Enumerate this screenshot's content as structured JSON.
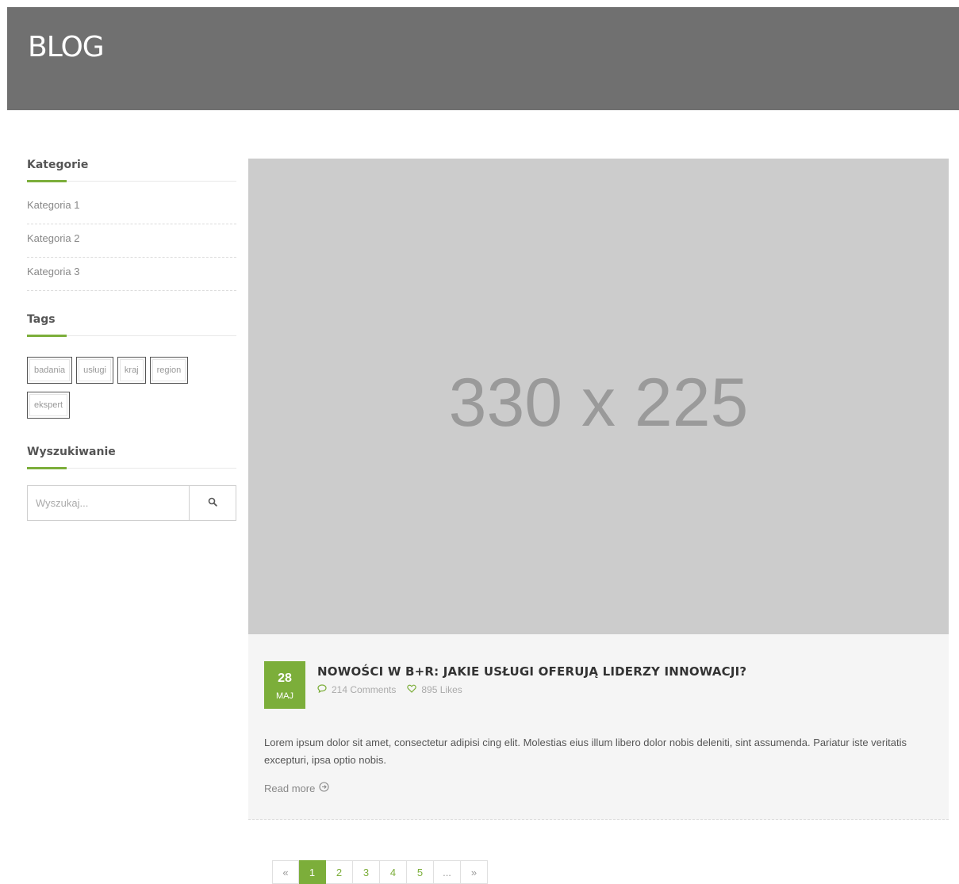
{
  "header": {
    "title": "BLOG"
  },
  "sidebar": {
    "categories": {
      "title": "Kategorie",
      "items": [
        {
          "label": "Kategoria 1"
        },
        {
          "label": "Kategoria 2"
        },
        {
          "label": "Kategoria 3"
        }
      ]
    },
    "tags": {
      "title": "Tags",
      "items": [
        {
          "label": "badania"
        },
        {
          "label": "usługi"
        },
        {
          "label": "kraj"
        },
        {
          "label": "region"
        },
        {
          "label": "ekspert"
        }
      ]
    },
    "search": {
      "title": "Wyszukiwanie",
      "placeholder": "Wyszukaj...",
      "button_icon": "search-icon"
    }
  },
  "post": {
    "image_placeholder": "330 x 225",
    "date": {
      "day": "28",
      "month": "MAJ"
    },
    "title": "NOWOŚCI W B+R: JAKIE USŁUGI OFERUJĄ LIDERZY INNOWACJI?",
    "comments": "214 Comments",
    "likes": "895 Likes",
    "excerpt": "Lorem ipsum dolor sit amet, consectetur adipisi cing elit. Molestias eius illum libero dolor nobis deleniti, sint assumenda. Pariatur iste veritatis excepturi, ipsa optio nobis.",
    "read_more": "Read more"
  },
  "pagination": {
    "prev": "«",
    "pages": [
      "1",
      "2",
      "3",
      "4",
      "5",
      "..."
    ],
    "next": "»",
    "active_page": "1"
  },
  "colors": {
    "accent": "#7cae3a",
    "header_bg": "#707070",
    "image_placeholder_bg": "#cccccc",
    "post_bg": "#f5f5f5"
  }
}
